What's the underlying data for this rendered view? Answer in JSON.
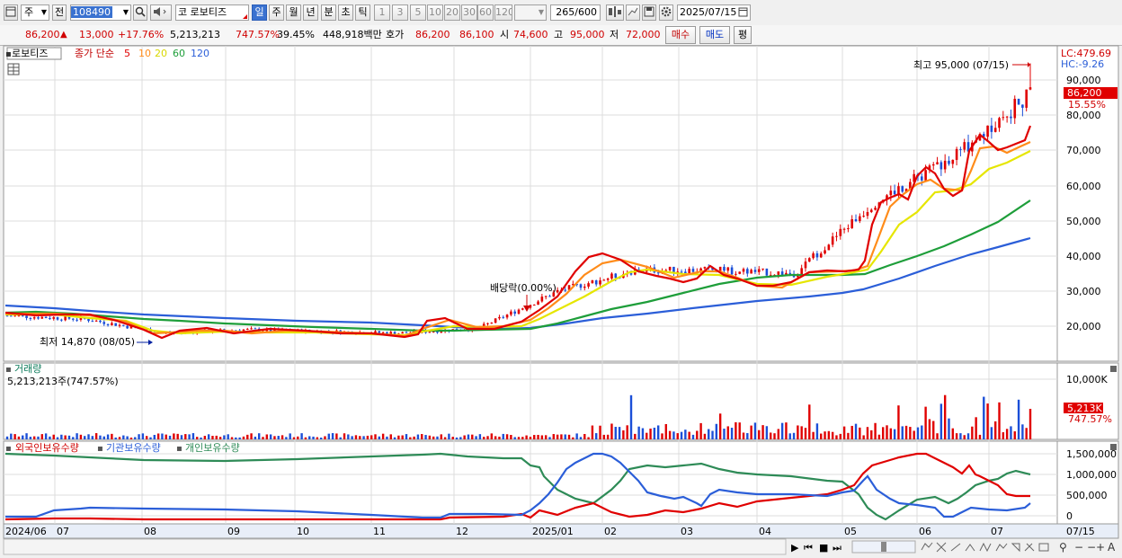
{
  "toolbar": {
    "market_label": "주",
    "period_label": "전",
    "code_value": "108490",
    "name_prefix": "코",
    "stock_name": "로보티즈",
    "tf_day": "일",
    "tf_week": "주",
    "tf_month": "월",
    "tf_year": "년",
    "tf_minute": "분",
    "tf_second": "초",
    "tf_tick": "틱",
    "tick_intervals": [
      "1",
      "3",
      "5",
      "10",
      "20",
      "30",
      "60",
      "120"
    ],
    "count_value": "265",
    "count_total": "/600",
    "date_value": "2025/07/15"
  },
  "quote": {
    "price": "86,200",
    "up_arrow": "▲",
    "change": "13,000",
    "change_pct": "+17.76%",
    "volume": "5,213,213",
    "volume_ratio": "747.57%",
    "turnover": "39.45%",
    "amount": "448,918백만",
    "ask_label": "호가",
    "ask_price": "86,200",
    "bid_price": "86,100",
    "open_label": "시",
    "open_price": "74,600",
    "high_label": "고",
    "high_price": "95,000",
    "low_label": "저",
    "low_price": "72,000",
    "buy_label": "매수",
    "sell_label": "매도",
    "eval_label": "평"
  },
  "price_panel": {
    "stock_tag": "로보티즈",
    "ma_title": "종가 단순",
    "ma_periods": [
      "5",
      "10",
      "20",
      "60",
      "120"
    ],
    "ma_colors": [
      "#e00000",
      "#ff8c1a",
      "#e6e600",
      "#1e9e3a",
      "#2b5ed8"
    ],
    "lc_label": "LC:479.69",
    "hc_label": "HC:-9.26",
    "last_price": "86,200",
    "last_pct": "15.55%",
    "max_annotation": "최고 95,000 (07/15)",
    "min_annotation": "최저 14,870 (08/05)",
    "dividend_annotation": "배당락(0.00%)",
    "y_ticks": [
      "90,000",
      "80,000",
      "70,000",
      "60,000",
      "50,000",
      "40,000",
      "30,000",
      "20,000"
    ]
  },
  "volume_panel": {
    "title": "거래량",
    "value": "5,213,213주(747.57%)",
    "y_tick": "10,000K",
    "last_value": "5,213K",
    "last_pct": "747.57%"
  },
  "holdings_panel": {
    "legend": [
      "외국인보유수량",
      "기관보유수량",
      "개인보유수량"
    ],
    "colors": [
      "#e00000",
      "#2b5ed8",
      "#2e8b57"
    ],
    "y_ticks": [
      "1,500,000",
      "1,000,000",
      "500,000",
      "0"
    ]
  },
  "x_axis": {
    "labels": [
      "2024/06",
      "07",
      "08",
      "09",
      "10",
      "11",
      "12",
      "2025/01",
      "02",
      "03",
      "04",
      "05",
      "06",
      "07",
      "07/15"
    ]
  },
  "chart_data": {
    "type": "candlestick",
    "x_range": [
      "2024/06",
      "2025/07/15"
    ],
    "ylim": [
      10000,
      100000
    ],
    "approx_close_monthly": [
      {
        "month": "2024/06",
        "close": 23000
      },
      {
        "month": "2024/07",
        "close": 22000
      },
      {
        "month": "2024/08",
        "close": 18000
      },
      {
        "month": "2024/09",
        "close": 19000
      },
      {
        "month": "2024/10",
        "close": 18500
      },
      {
        "month": "2024/11",
        "close": 18000
      },
      {
        "month": "2024/12",
        "close": 19500
      },
      {
        "month": "2025/01",
        "close": 30000
      },
      {
        "month": "2025/02",
        "close": 36000
      },
      {
        "month": "2025/03",
        "close": 36000
      },
      {
        "month": "2025/04",
        "close": 35000
      },
      {
        "month": "2025/05",
        "close": 55000
      },
      {
        "month": "2025/06",
        "close": 68000
      },
      {
        "month": "2025/07",
        "close": 86200
      }
    ],
    "high": {
      "value": 95000,
      "date": "07/15"
    },
    "low": {
      "value": 14870,
      "date": "08/05"
    }
  }
}
